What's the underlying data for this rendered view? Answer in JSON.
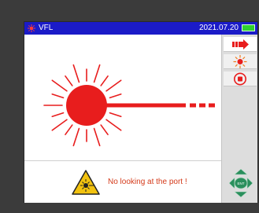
{
  "header": {
    "mode_title": "VFL",
    "date": "2021.07.20",
    "battery_color": "#2fd12f"
  },
  "main": {
    "warning_text": "No looking at the port !"
  },
  "sidebar": {
    "buttons": [
      {
        "icon": "red-arrow-icon"
      },
      {
        "icon": "laser-sun-icon"
      },
      {
        "icon": "stop-record-icon"
      }
    ],
    "nav_center_label": "ENT"
  },
  "colors": {
    "title_bar": "#1b1bc8",
    "laser": "#e81d1d",
    "warning_text": "#d43a1a",
    "nav_green": "#2a8f5c"
  }
}
